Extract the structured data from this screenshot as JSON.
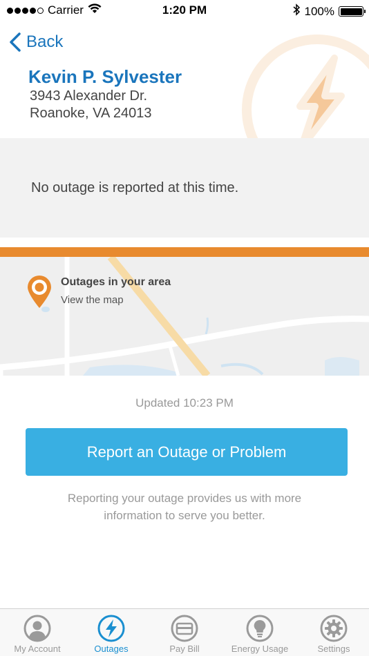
{
  "status_bar": {
    "carrier": "Carrier",
    "time": "1:20 PM",
    "battery": "100%"
  },
  "header": {
    "back_label": "Back",
    "name": "Kevin P. Sylvester",
    "address_line1": "3943 Alexander Dr.",
    "address_line2": "Roanoke, VA 24013"
  },
  "outage_status": {
    "message": "No outage is reported at this time."
  },
  "map_card": {
    "title": "Outages in your area",
    "subtitle": "View the map"
  },
  "updated": "Updated 10:23 PM",
  "report_button": "Report an Outage or Problem",
  "info_text": "Reporting your outage provides us with more information to serve you better.",
  "tabs": [
    {
      "label": "My Account",
      "icon": "user-icon",
      "active": false
    },
    {
      "label": "Outages",
      "icon": "lightning-icon",
      "active": true
    },
    {
      "label": "Pay Bill",
      "icon": "credit-card-icon",
      "active": false
    },
    {
      "label": "Energy Usage",
      "icon": "lightbulb-icon",
      "active": false
    },
    {
      "label": "Settings",
      "icon": "gear-icon",
      "active": false
    }
  ],
  "colors": {
    "brand_blue": "#1a75bc",
    "button_blue": "#39afe2",
    "accent_orange": "#e88a2e",
    "active_tab": "#1a8fd0"
  }
}
